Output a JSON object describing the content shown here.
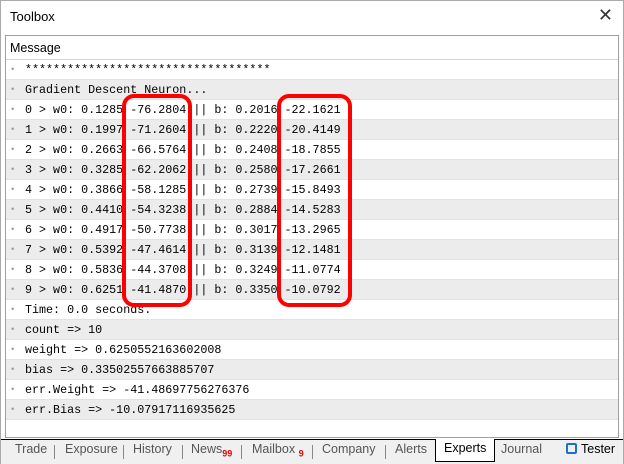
{
  "window": {
    "title": "Toolbox"
  },
  "log": {
    "header": "Message",
    "lines": [
      "***********************************",
      "Gradient Descent Neuron...",
      "0 > w0: 0.1285 -76.2804 || b: 0.2016 -22.1621",
      "1 > w0: 0.1997 -71.2604 || b: 0.2220 -20.4149",
      "2 > w0: 0.2663 -66.5764 || b: 0.2408 -18.7855",
      "3 > w0: 0.3285 -62.2062 || b: 0.2580 -17.2661",
      "4 > w0: 0.3866 -58.1285 || b: 0.2739 -15.8493",
      "5 > w0: 0.4410 -54.3238 || b: 0.2884 -14.5283",
      "6 > w0: 0.4917 -50.7738 || b: 0.3017 -13.2965",
      "7 > w0: 0.5392 -47.4614 || b: 0.3139 -12.1481",
      "8 > w0: 0.5836 -44.3708 || b: 0.3249 -11.0774",
      "9 > w0: 0.6251 -41.4870 || b: 0.3350 -10.0792",
      "Time: 0.0 seconds.",
      "count => 10",
      "weight => 0.6250552163602008",
      "bias => 0.33502557663885707",
      "err.Weight => -41.48697756276376",
      "err.Bias => -10.07917116935625"
    ]
  },
  "highlight_color": "#ff0000",
  "tabs": [
    {
      "label": "Trade"
    },
    {
      "label": "Exposure"
    },
    {
      "label": "History"
    },
    {
      "label": "News",
      "badge": "99"
    },
    {
      "label": "Mailbox",
      "badge": "9"
    },
    {
      "label": "Company"
    },
    {
      "label": "Alerts"
    },
    {
      "label": "Experts",
      "active": true
    },
    {
      "label": "Journal"
    },
    {
      "label": "Tester",
      "icon": "chip-icon"
    }
  ]
}
